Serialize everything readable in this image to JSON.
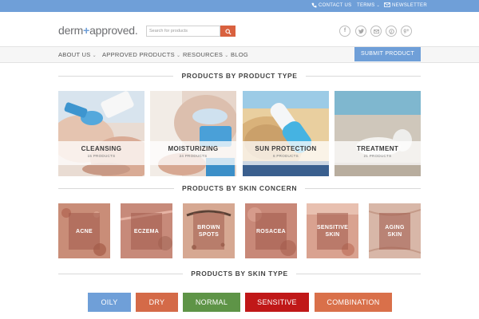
{
  "topbar": {
    "contact": "CONTACT US",
    "terms": "TERMS",
    "newsletter": "NEWSLETTER"
  },
  "header": {
    "logo_left": "derm",
    "logo_plus": "+",
    "logo_right": "approved.",
    "search_placeholder": "Search for products",
    "social_icons": [
      "facebook-icon",
      "twitter-icon",
      "email-icon",
      "pinterest-icon",
      "google-plus-icon"
    ]
  },
  "nav": {
    "items": [
      {
        "label": "ABOUT US",
        "has_dropdown": true
      },
      {
        "label": "APPROVED PRODUCTS",
        "has_dropdown": true
      },
      {
        "label": "RESOURCES",
        "has_dropdown": true
      },
      {
        "label": "BLOG",
        "has_dropdown": false
      }
    ],
    "submit_label": "SUBMIT PRODUCT"
  },
  "sections": {
    "product_type": "PRODUCTS BY PRODUCT TYPE",
    "skin_concern": "PRODUCTS BY SKIN CONCERN",
    "skin_type": "PRODUCTS BY SKIN TYPE"
  },
  "product_types": [
    {
      "name": "CLEANSING",
      "count": "15 PRODUCTS"
    },
    {
      "name": "MOISTURIZING",
      "count": "24 PRODUCTS"
    },
    {
      "name": "SUN PROTECTION",
      "count": "6 PRODUCTS"
    },
    {
      "name": "TREATMENT",
      "count": "21 PRODUCTS"
    }
  ],
  "skin_concerns": [
    {
      "name": "ACNE"
    },
    {
      "name": "ECZEMA"
    },
    {
      "name": "BROWN SPOTS"
    },
    {
      "name": "ROSACEA"
    },
    {
      "name": "SENSITIVE SKIN"
    },
    {
      "name": "AGING SKIN"
    }
  ],
  "skin_types": [
    {
      "label": "OILY",
      "color": "#6f9fd8"
    },
    {
      "label": "DRY",
      "color": "#d46a48"
    },
    {
      "label": "NORMAL",
      "color": "#5e9447"
    },
    {
      "label": "SENSITIVE",
      "color": "#c01818"
    },
    {
      "label": "COMBINATION",
      "color": "#d9704a"
    }
  ],
  "colors": {
    "accent_blue": "#6f9fd8",
    "accent_orange": "#d9613f"
  }
}
